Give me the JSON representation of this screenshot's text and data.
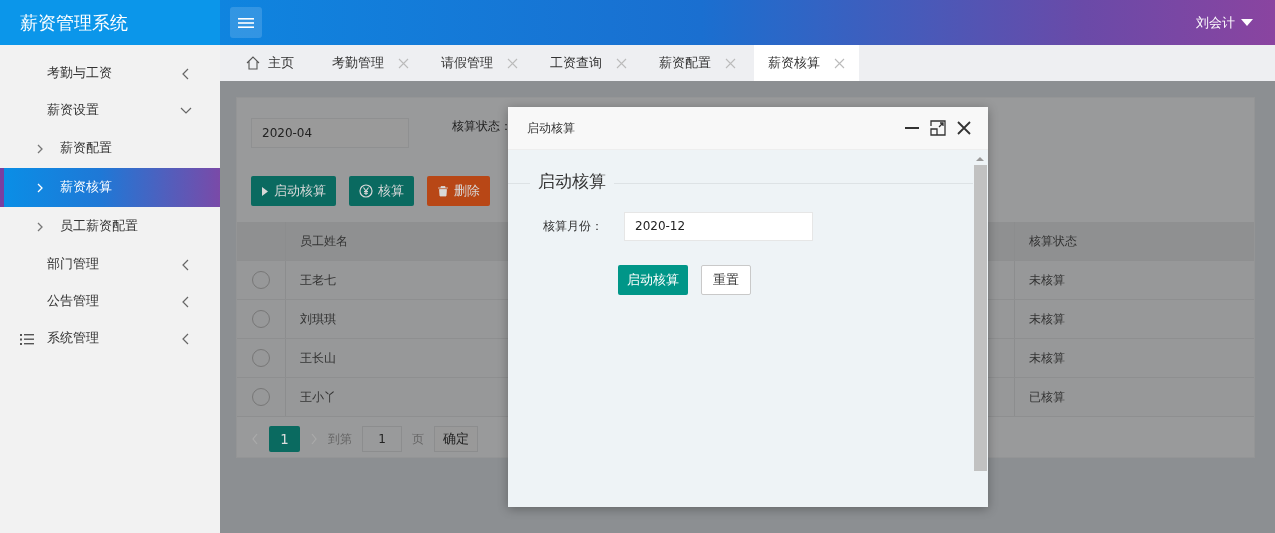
{
  "header": {
    "title": "薪资管理系统",
    "user": "刘会计"
  },
  "sidebar": {
    "items": [
      {
        "label": "考勤与工资",
        "kind": "plain",
        "expanded": false,
        "selected": false
      },
      {
        "label": "薪资设置",
        "kind": "plain",
        "expanded": true,
        "selected": false,
        "children": [
          {
            "label": "薪资配置",
            "selected": false
          },
          {
            "label": "薪资核算",
            "selected": true
          },
          {
            "label": "员工薪资配置",
            "selected": false
          }
        ]
      },
      {
        "label": "部门管理",
        "kind": "plain",
        "expanded": false,
        "selected": false
      },
      {
        "label": "公告管理",
        "kind": "plain",
        "expanded": false,
        "selected": false
      },
      {
        "label": "系统管理",
        "kind": "with_icon",
        "expanded": false,
        "selected": false
      }
    ]
  },
  "tabs": [
    {
      "label": "主页",
      "kind": "home",
      "selected": false
    },
    {
      "label": "考勤管理",
      "kind": "page",
      "selected": false
    },
    {
      "label": "请假管理",
      "kind": "page",
      "selected": false
    },
    {
      "label": "工资查询",
      "kind": "page",
      "selected": false
    },
    {
      "label": "薪资配置",
      "kind": "page",
      "selected": false
    },
    {
      "label": "薪资核算",
      "kind": "page",
      "selected": true
    }
  ],
  "content": {
    "month_field": "2020-04",
    "status_label": "核算状态：",
    "toolbar": [
      {
        "label": "启动核算",
        "kind": "start"
      },
      {
        "label": "核算",
        "kind": "calc"
      },
      {
        "label": "删除",
        "kind": "delete"
      }
    ],
    "table": {
      "columns": [
        "员工姓名",
        "核算状态"
      ],
      "rows": [
        {
          "name": "王老七",
          "status": "未核算",
          "selected": false
        },
        {
          "name": "刘琪琪",
          "status": "未核算",
          "selected": false
        },
        {
          "name": "王长山",
          "status": "未核算",
          "selected": false
        },
        {
          "name": "王小丫",
          "status": "已核算",
          "selected": false
        }
      ]
    },
    "pagination": {
      "pages": [
        {
          "label": "1",
          "selected": true
        }
      ],
      "goto_label": "到第",
      "page_input": "1",
      "page_unit": "页",
      "confirm": "确定"
    }
  },
  "modal": {
    "title": "启动核算",
    "legend": "启动核算",
    "field_label": "核算月份：",
    "field_value": "2020-12",
    "buttons": [
      {
        "label": "启动核算",
        "kind": "primary"
      },
      {
        "label": "重置",
        "kind": "plain"
      }
    ]
  }
}
